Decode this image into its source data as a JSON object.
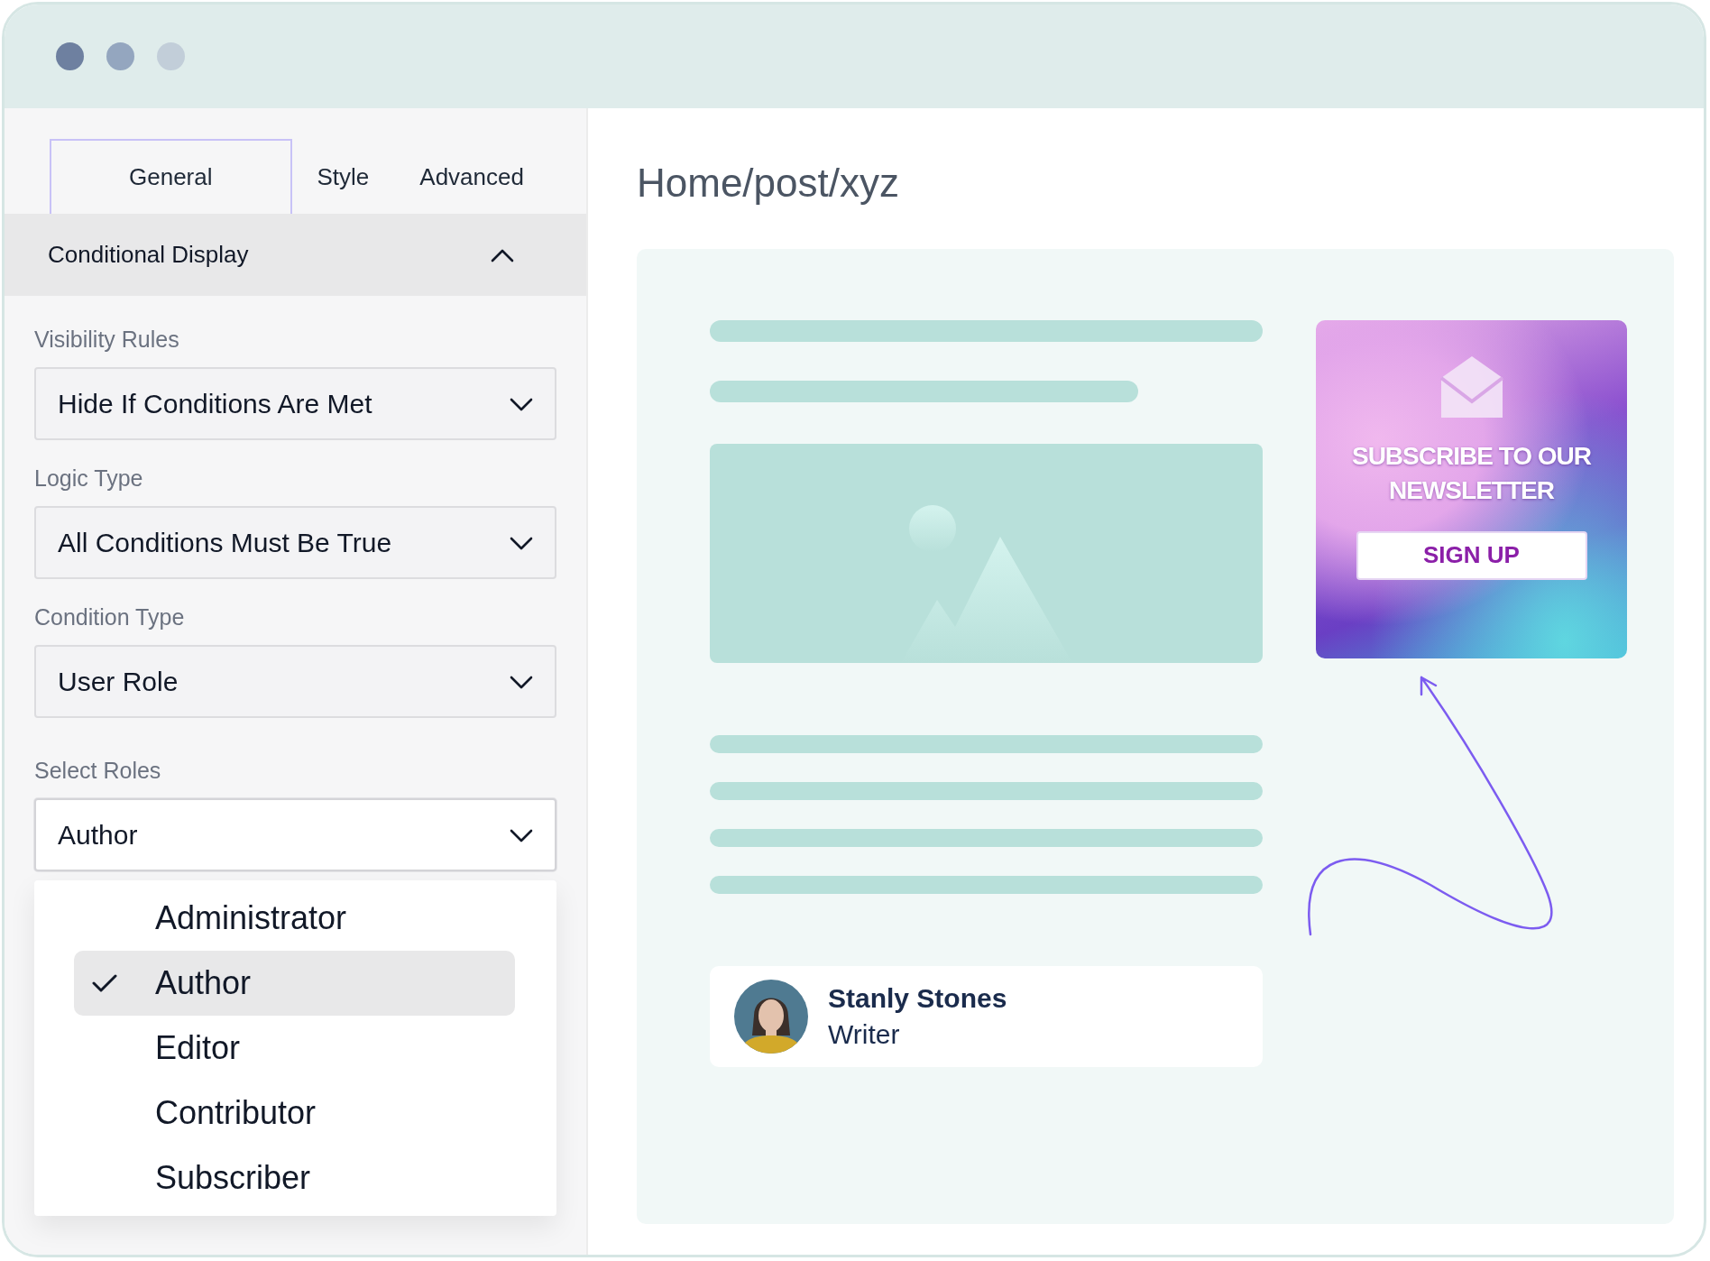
{
  "tabs": [
    {
      "label": "General",
      "selected": true
    },
    {
      "label": "Style",
      "selected": false
    },
    {
      "label": "Advanced",
      "selected": false
    }
  ],
  "section": {
    "title": "Conditional Display",
    "expanded": true
  },
  "fields": [
    {
      "label": "Visibility Rules",
      "value": "Hide If Conditions Are Met"
    },
    {
      "label": "Logic Type",
      "value": "All Conditions Must Be True"
    },
    {
      "label": "Condition Type",
      "value": "User Role"
    },
    {
      "label": "Select Roles",
      "value": "Author",
      "open": true
    }
  ],
  "role_options": [
    {
      "label": "Administrator",
      "selected": false
    },
    {
      "label": "Author",
      "selected": true
    },
    {
      "label": "Editor",
      "selected": false
    },
    {
      "label": "Contributor",
      "selected": false
    },
    {
      "label": "Subscriber",
      "selected": false
    }
  ],
  "preview": {
    "path": "Home/post/xyz",
    "author": {
      "name": "Stanly Stones",
      "role": "Writer"
    },
    "newsletter": {
      "title": "SUBSCRIBE TO OUR NEWSLETTER",
      "button": "SIGN UP"
    }
  }
}
